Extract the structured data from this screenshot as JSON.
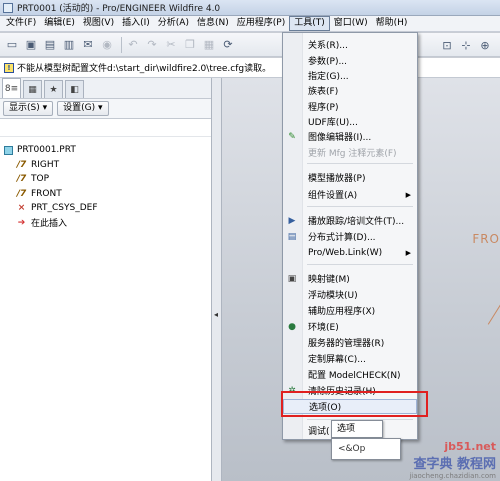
{
  "window": {
    "title": "PRT0001 (活动的) - Pro/ENGINEER Wildfire 4.0"
  },
  "menubar": [
    "文件(F)",
    "编辑(E)",
    "视图(V)",
    "插入(I)",
    "分析(A)",
    "信息(N)",
    "应用程序(P)",
    "工具(T)",
    "窗口(W)",
    "帮助(H)"
  ],
  "message": "不能从模型树配置文件d:\\start_dir\\wildfire2.0\\tree.cfg读取。",
  "panel": {
    "show_label": "显示(S) ▾",
    "settings_label": "设置(G) ▾"
  },
  "tree": {
    "root": "PRT0001.PRT",
    "items": [
      "RIGHT",
      "TOP",
      "FRONT",
      "PRT_CSYS_DEF",
      "在此插入"
    ]
  },
  "viewport": {
    "datum_label": "FRO"
  },
  "tools_menu": {
    "items": [
      {
        "label": "关系(R)...",
        "icon": ""
      },
      {
        "label": "参数(P)...",
        "icon": ""
      },
      {
        "label": "指定(G)...",
        "icon": ""
      },
      {
        "label": "族表(F)",
        "icon": ""
      },
      {
        "label": "程序(P)",
        "icon": ""
      },
      {
        "label": "UDF库(U)...",
        "icon": ""
      },
      {
        "label": "图像编辑器(I)...",
        "icon": "image-editor-icon"
      },
      {
        "label": "更新 Mfg 注释元素(F)",
        "icon": "",
        "disabled": true
      },
      {
        "label": "模型播放器(P)",
        "icon": ""
      },
      {
        "label": "组件设置(A)",
        "icon": "",
        "submenu": true
      },
      {
        "label": "播放跟踪/培训文件(T)...",
        "icon": "trail-icon"
      },
      {
        "label": "分布式计算(D)...",
        "icon": "distributed-icon"
      },
      {
        "label": "Pro/Web.Link(W)",
        "icon": "",
        "submenu": true
      },
      {
        "label": "映射键(M)",
        "icon": "mapkey-icon"
      },
      {
        "label": "浮动模块(U)",
        "icon": ""
      },
      {
        "label": "辅助应用程序(X)",
        "icon": ""
      },
      {
        "label": "环境(E)",
        "icon": "environment-icon"
      },
      {
        "label": "服务器的管理器(R)",
        "icon": ""
      },
      {
        "label": "定制屏幕(C)...",
        "icon": ""
      },
      {
        "label": "配置 ModelCHECK(N)",
        "icon": ""
      },
      {
        "label": "清除历史记录(H)",
        "icon": "clear-history-icon"
      },
      {
        "label": "选项(O)",
        "icon": "",
        "selected": true
      },
      {
        "label": "调试(",
        "icon": ""
      }
    ]
  },
  "tooltip": {
    "label": "选项",
    "sub": "<&Op"
  },
  "watermark": {
    "line1": "jb51.net",
    "line2": "查字典 教程网",
    "line3": "jiaocheng.chazidian.com"
  }
}
